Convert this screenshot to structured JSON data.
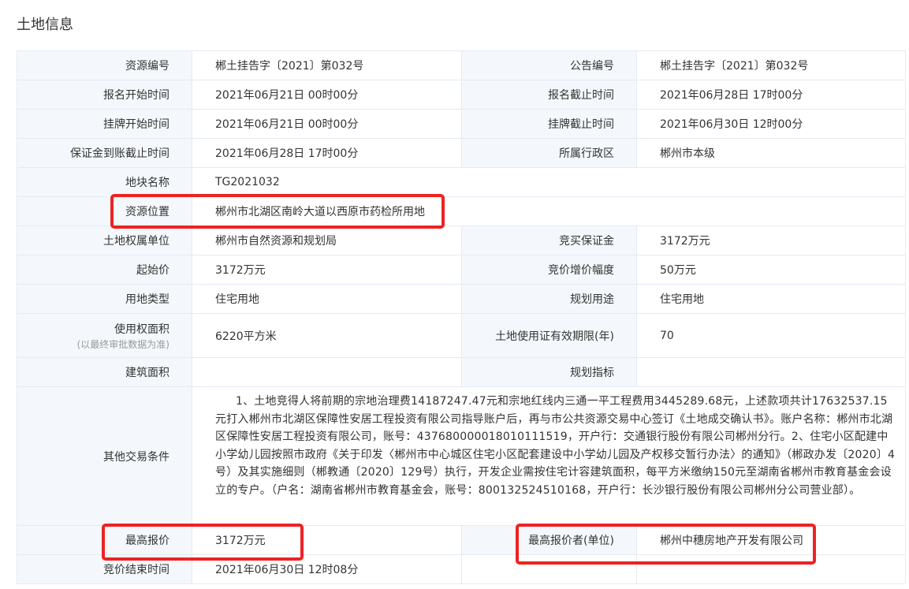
{
  "section_title": "土地信息",
  "rows": {
    "r1": {
      "l1": "资源编号",
      "v1": "郴土挂告字〔2021〕第032号",
      "l2": "公告编号",
      "v2": "郴土挂告字〔2021〕第032号"
    },
    "r2": {
      "l1": "报名开始时间",
      "v1": "2021年06月21日 00时00分",
      "l2": "报名截止时间",
      "v2": "2021年06月28日 17时00分"
    },
    "r3": {
      "l1": "挂牌开始时间",
      "v1": "2021年06月21日 00时00分",
      "l2": "挂牌截止时间",
      "v2": "2021年06月30日 12时00分"
    },
    "r4": {
      "l1": "保证金到账截止时间",
      "v1": "2021年06月28日 17时00分",
      "l2": "所属行政区",
      "v2": "郴州市本级"
    },
    "r5": {
      "l1": "地块名称",
      "v1": "TG2021032"
    },
    "r6": {
      "l1": "资源位置",
      "v1": "郴州市北湖区南岭大道以西原市药检所用地"
    },
    "r7": {
      "l1": "土地权属单位",
      "v1": "郴州市自然资源和规划局",
      "l2": "竞买保证金",
      "v2": "3172万元"
    },
    "r8": {
      "l1": "起始价",
      "v1": "3172万元",
      "l2": "竞价增价幅度",
      "v2": "50万元"
    },
    "r9": {
      "l1": "用地类型",
      "v1": "住宅用地",
      "l2": "规划用途",
      "v2": "住宅用地"
    },
    "r10": {
      "l1": "使用权面积",
      "l1_sub": "(以最终审批数据为准)",
      "v1": "6220平方米",
      "l2": "土地使用证有效期限(年)",
      "v2": "70"
    },
    "r11": {
      "l1": "建筑面积",
      "v1": "",
      "l2": "规划指标",
      "v2": ""
    },
    "r12": {
      "l1": "其他交易条件",
      "v1": "1、土地竞得人将前期的宗地治理费14187247.47元和宗地红线内三通一平工程费用3445289.68元，上述款项共计17632537.15元打入郴州市北湖区保障性安居工程投资有限公司指导账户后，再与市公共资源交易中心签订《土地成交确认书》。账户名称：郴州市北湖区保障性安居工程投资有限公司，账号：43768000001801011151​9，开户行：交通银行股份有限公司郴州分行。2、住宅小区配建中小学幼儿园按照市政府《关于印发〈郴州市中心城区住宅小区配套建设中小学幼儿园及产权移交暂行办法〉的通知》（郴政办发〔2020〕4号）及其实施细则（郴教通〔2020〕129号）执行，开发企业需按住宅计容建筑面积，每平方米缴纳150元至湖南省郴州市教育基金会设立的专户。（户名：湖南省郴州市教育基金会，账号：800132524510168，开户行：长沙银行股份有限公司郴州分公司营业部）。"
    },
    "r13": {
      "l1": "最高报价",
      "v1": "3172万元",
      "l2": "最高报价者(单位)",
      "v2": "郴州中穗房地产开发有限公司"
    },
    "r14": {
      "l1": "竞价结束时间",
      "v1": "2021年06月30日 12时08分"
    }
  },
  "colors": {
    "label_bg": "#f4f8fc",
    "border": "#e4ebf3",
    "condition_text": "#e02020",
    "highlight": "#ee2222"
  }
}
